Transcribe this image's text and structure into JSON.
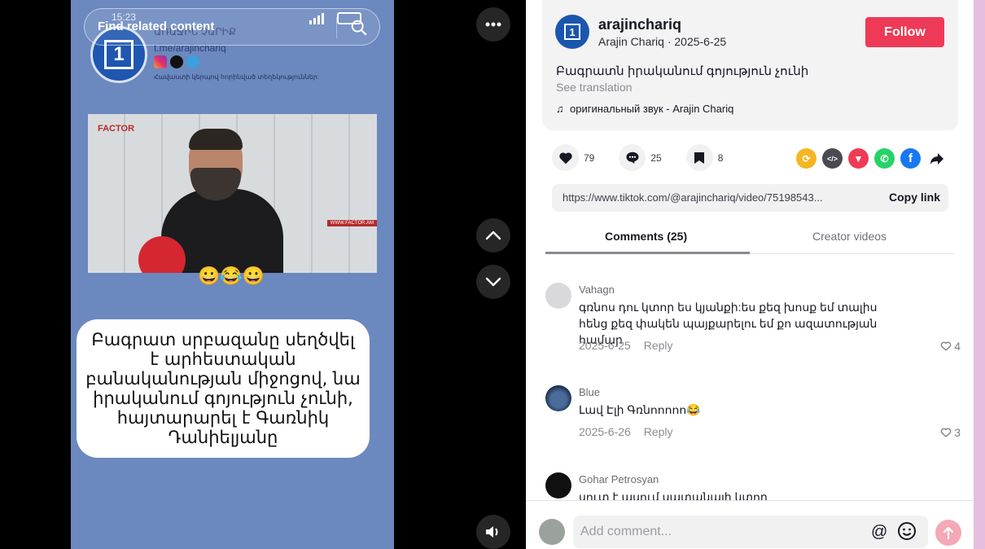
{
  "video": {
    "status_time": "15:23",
    "search_placeholder": "Find related content",
    "channel_name": "ԱՌԱՋԻՆ ՉԱՐԻՔ",
    "channel_link": "t.me/arajinchariq",
    "tagline": "Հավաստի կերպով հորինված տեղեկություններ:",
    "clip_logo": "FACTOR",
    "clip_tag": "WWW.FACTOR.AM",
    "emoji": "😀😂😀",
    "caption": "Բագրատ սրբազանը սեղծվել է արհեստական բանականության միջոցով, նա իրականում գոյություն չունի, հայտարարել է Գառնիկ Դանիելյանը"
  },
  "post": {
    "handle": "arajinchariq",
    "subline": "Arajin Chariq · 2025-6-25",
    "follow_label": "Follow",
    "description": "Բագրատն իրականում գոյություն չունի",
    "see_translation": "See translation",
    "music": "оригинальный звук - Arajin Chariq"
  },
  "actions": {
    "likes": "79",
    "comments": "25",
    "saves": "8"
  },
  "share": {
    "url": "https://www.tiktok.com/@arajinchariq/video/75198543...",
    "copy_label": "Copy link",
    "colors": {
      "repost": "#f5b621",
      "embed": "#4a4a52",
      "send": "#ef3c55",
      "whatsapp": "#25d366",
      "facebook": "#1877f2"
    }
  },
  "tabs": {
    "comments": "Comments (25)",
    "creator": "Creator videos"
  },
  "comments": [
    {
      "user": "Vahagn",
      "text": "գռնոս դու կտոր ես կյանքի:ես քեզ խոսք եմ տալիս հենց քեզ փակեն պայքարելու եմ քո ազատության համար",
      "date": "2025-6-25",
      "reply": "Reply",
      "likes": "4"
    },
    {
      "user": "Blue",
      "text": "Լավ Էլի Գռնոոոոո😂",
      "date": "2025-6-26",
      "reply": "Reply",
      "likes": "3"
    },
    {
      "user": "Gohar Petrosyan",
      "text": "սուտ է ասում սատանայի կտոր"
    }
  ],
  "footer": {
    "placeholder": "Add comment...",
    "at": "@"
  }
}
